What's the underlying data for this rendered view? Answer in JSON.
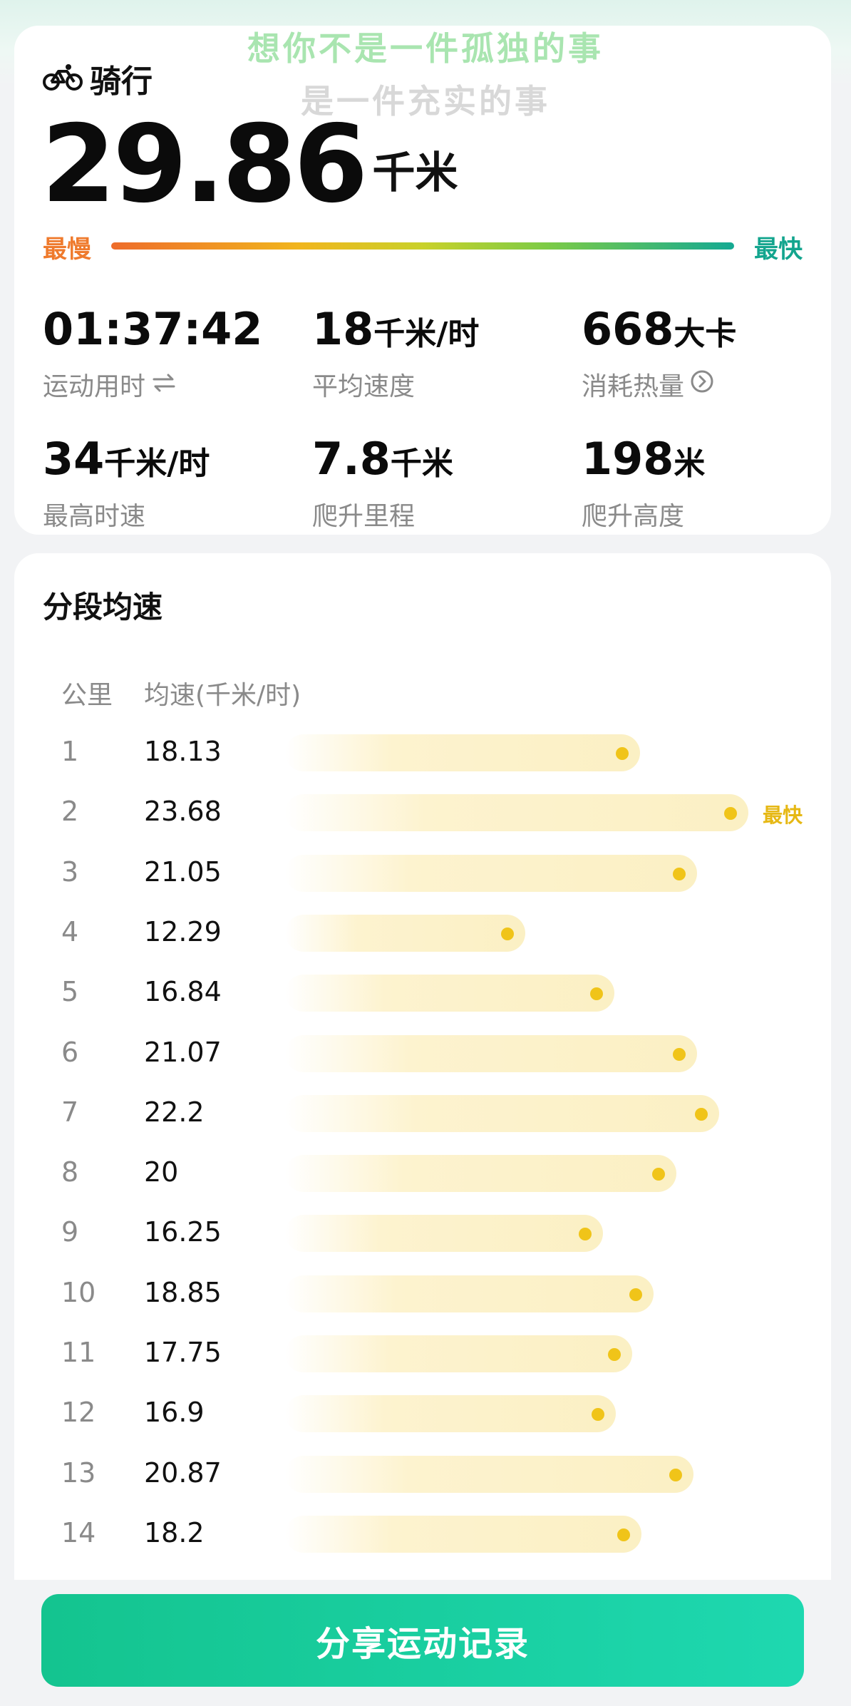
{
  "overlay": {
    "line1": "想你不是一件孤独的事",
    "line2": "是一件充实的事"
  },
  "summary": {
    "sport_icon": "bicycle-icon",
    "sport_label": "骑行",
    "distance_value": "29.86",
    "distance_unit": "千米",
    "range_slow": "最慢",
    "range_fast": "最快",
    "stats": [
      {
        "value": "01:37:42",
        "unit": "",
        "label": "运动用时",
        "label_icon": "swap-icon"
      },
      {
        "value": "18",
        "unit": "千米/时",
        "label": "平均速度",
        "label_icon": ""
      },
      {
        "value": "668",
        "unit": "大卡",
        "label": "消耗热量",
        "label_icon": "chevron-right-circle-icon"
      },
      {
        "value": "34",
        "unit": "千米/时",
        "label": "最高时速",
        "label_icon": ""
      },
      {
        "value": "7.8",
        "unit": "千米",
        "label": "爬升里程",
        "label_icon": ""
      },
      {
        "value": "198",
        "unit": "米",
        "label": "爬升高度",
        "label_icon": ""
      }
    ]
  },
  "splits": {
    "title": "分段均速",
    "col_km": "公里",
    "col_speed": "均速(千米/时)",
    "fastest_tag": "最快",
    "accent_color": "#f0c419",
    "rows": [
      {
        "km": "1",
        "speed": "18.13",
        "level": 18.13
      },
      {
        "km": "2",
        "speed": "23.68",
        "level": 23.68,
        "fastest": true
      },
      {
        "km": "3",
        "speed": "21.05",
        "level": 21.05
      },
      {
        "km": "4",
        "speed": "12.29",
        "level": 12.29
      },
      {
        "km": "5",
        "speed": "16.84",
        "level": 16.84
      },
      {
        "km": "6",
        "speed": "21.07",
        "level": 21.07
      },
      {
        "km": "7",
        "speed": "22.2",
        "level": 22.2
      },
      {
        "km": "8",
        "speed": "20",
        "level": 20
      },
      {
        "km": "9",
        "speed": "16.25",
        "level": 16.25
      },
      {
        "km": "10",
        "speed": "18.85",
        "level": 18.85
      },
      {
        "km": "11",
        "speed": "17.75",
        "level": 17.75
      },
      {
        "km": "12",
        "speed": "16.9",
        "level": 16.9
      },
      {
        "km": "13",
        "speed": "20.87",
        "level": 20.87
      },
      {
        "km": "14",
        "speed": "18.2",
        "level": 18.2
      }
    ]
  },
  "share": {
    "label": "分享运动记录",
    "color": "#14c48f"
  }
}
